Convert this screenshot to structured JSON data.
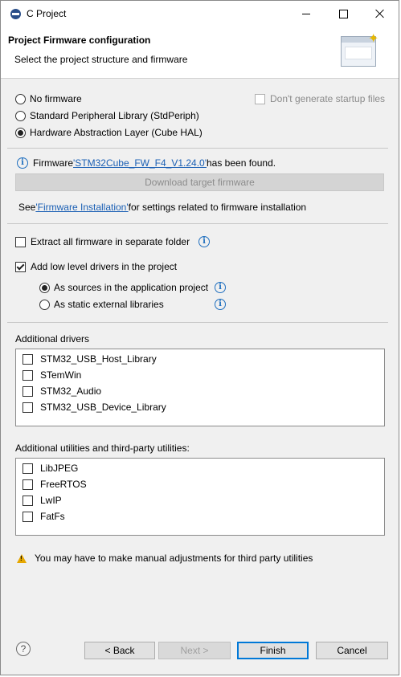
{
  "window": {
    "title": "C Project"
  },
  "header": {
    "title": "Project Firmware configuration",
    "subtitle": "Select the project structure and firmware"
  },
  "firmware_options": {
    "none": "No firmware",
    "stdperiph": "Standard Peripheral Library (StdPeriph)",
    "hal": "Hardware Abstraction Layer (Cube HAL)",
    "selected": "hal",
    "dont_generate_startup": "Don't generate startup files"
  },
  "firmware_status": {
    "prefix": "Firmware ",
    "link": "'STM32Cube_FW_F4_V1.24.0'",
    "suffix": " has been found.",
    "download_button": "Download target firmware",
    "see_prefix": "See ",
    "see_link": "'Firmware Installation'",
    "see_suffix": " for settings related to firmware installation"
  },
  "options": {
    "extract_all": "Extract all firmware in separate folder",
    "extract_all_checked": false,
    "add_low_level": "Add low level drivers in the project",
    "add_low_level_checked": true,
    "as_sources": "As sources in the application project",
    "as_static": "As static external libraries",
    "selected_mode": "as_sources"
  },
  "additional_drivers": {
    "label": "Additional drivers",
    "items": [
      {
        "label": "STM32_USB_Host_Library",
        "checked": false
      },
      {
        "label": "STemWin",
        "checked": false
      },
      {
        "label": "STM32_Audio",
        "checked": false
      },
      {
        "label": "STM32_USB_Device_Library",
        "checked": false
      }
    ]
  },
  "additional_utilities": {
    "label": "Additional utilities and third-party utilities:",
    "items": [
      {
        "label": "LibJPEG",
        "checked": false
      },
      {
        "label": "FreeRTOS",
        "checked": false
      },
      {
        "label": "LwIP",
        "checked": false
      },
      {
        "label": "FatFs",
        "checked": false
      }
    ]
  },
  "warning": "You may have to make manual adjustments for third party utilities",
  "buttons": {
    "help": "?",
    "back": "< Back",
    "next": "Next >",
    "finish": "Finish",
    "cancel": "Cancel"
  },
  "colors": {
    "link": "#1a5fb4",
    "default_button_border": "#0078d7",
    "warning": "#e6a700"
  }
}
